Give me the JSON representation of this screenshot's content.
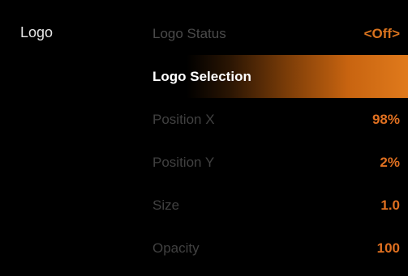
{
  "sidebar": {
    "section_label": "Logo"
  },
  "menu": {
    "items": [
      {
        "label": "Logo Status",
        "value": "<Off>"
      },
      {
        "label": "Logo Selection",
        "value": ""
      },
      {
        "label": "Position X",
        "value": "98%"
      },
      {
        "label": "Position Y",
        "value": "2%"
      },
      {
        "label": "Size",
        "value": "1.0"
      },
      {
        "label": "Opacity",
        "value": "100"
      }
    ],
    "selected_index": 1
  },
  "colors": {
    "background": "#000000",
    "accent": "#d9731e",
    "selected_text": "#ffffff",
    "dim_text": "#414141"
  }
}
